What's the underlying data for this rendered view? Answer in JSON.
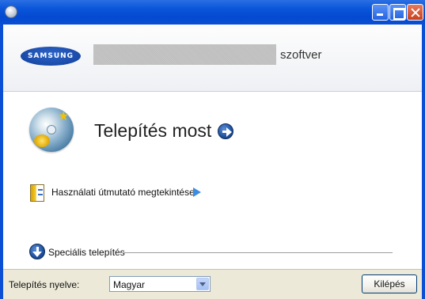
{
  "window": {
    "title": "",
    "controls": {
      "minimize_icon": "minimize-icon",
      "maximize_icon": "maximize-icon",
      "close_icon": "close-icon"
    },
    "colors": {
      "titlebar": "#0a56da",
      "close_button": "#c8401c"
    }
  },
  "header": {
    "logo_text": "SAMSUNG",
    "product_suffix": "szoftver"
  },
  "main": {
    "install": {
      "label": "Telepítés most",
      "icon": "install-cd-icon",
      "arrow_icon": "go-arrow-icon"
    },
    "manual": {
      "label": "Használati útmutató megtekintése",
      "icon": "manual-book-icon",
      "arrow_icon": "play-arrow-icon"
    },
    "special_install": {
      "label": "Speciális telepítés",
      "icon": "expand-down-icon"
    }
  },
  "footer": {
    "language_label": "Telepítés nyelve:",
    "language_value": "Magyar",
    "exit_label": "Kilépés"
  }
}
